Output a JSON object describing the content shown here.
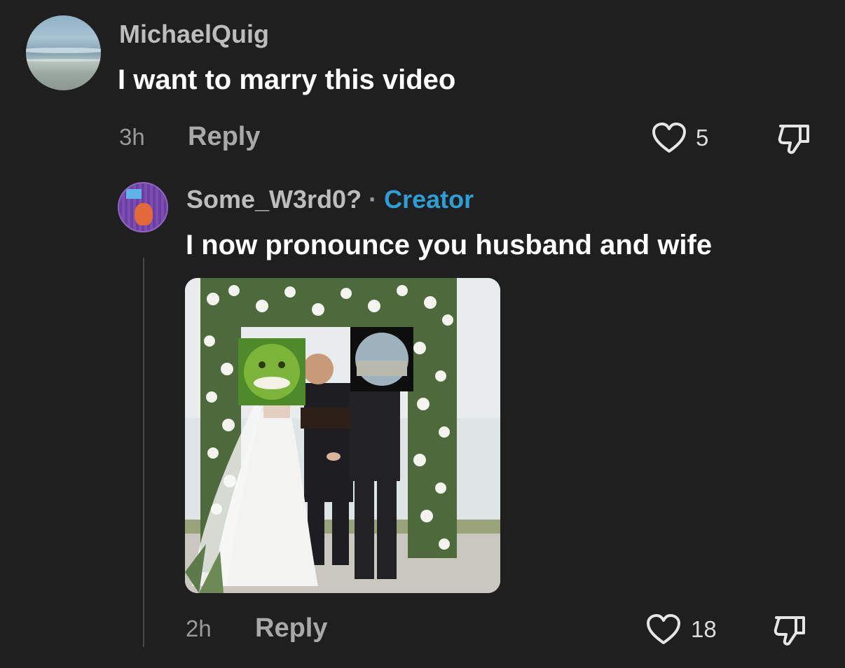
{
  "comment": {
    "username": "MichaelQuig",
    "text": "I want to marry this video",
    "time": "3h",
    "reply_label": "Reply",
    "like_count": "5",
    "avatar_icon": "beach-avatar-icon"
  },
  "reply_comment": {
    "username": "Some_W3rd0?",
    "separator": "·",
    "badge": "Creator",
    "text": "I now pronounce you husband and wife",
    "time": "2h",
    "reply_label": "Reply",
    "like_count": "18",
    "avatar_icon": "purple-avatar-icon",
    "attachment_icon": "wedding-photo-image"
  },
  "colors": {
    "background": "#1f1f1f",
    "creator_accent": "#2e9fd6",
    "username": "#bdbdbd",
    "body_text": "#ffffff",
    "muted": "#9a9a9a"
  },
  "icons": {
    "like": "heart-outline-icon",
    "dislike": "thumbs-down-icon"
  }
}
